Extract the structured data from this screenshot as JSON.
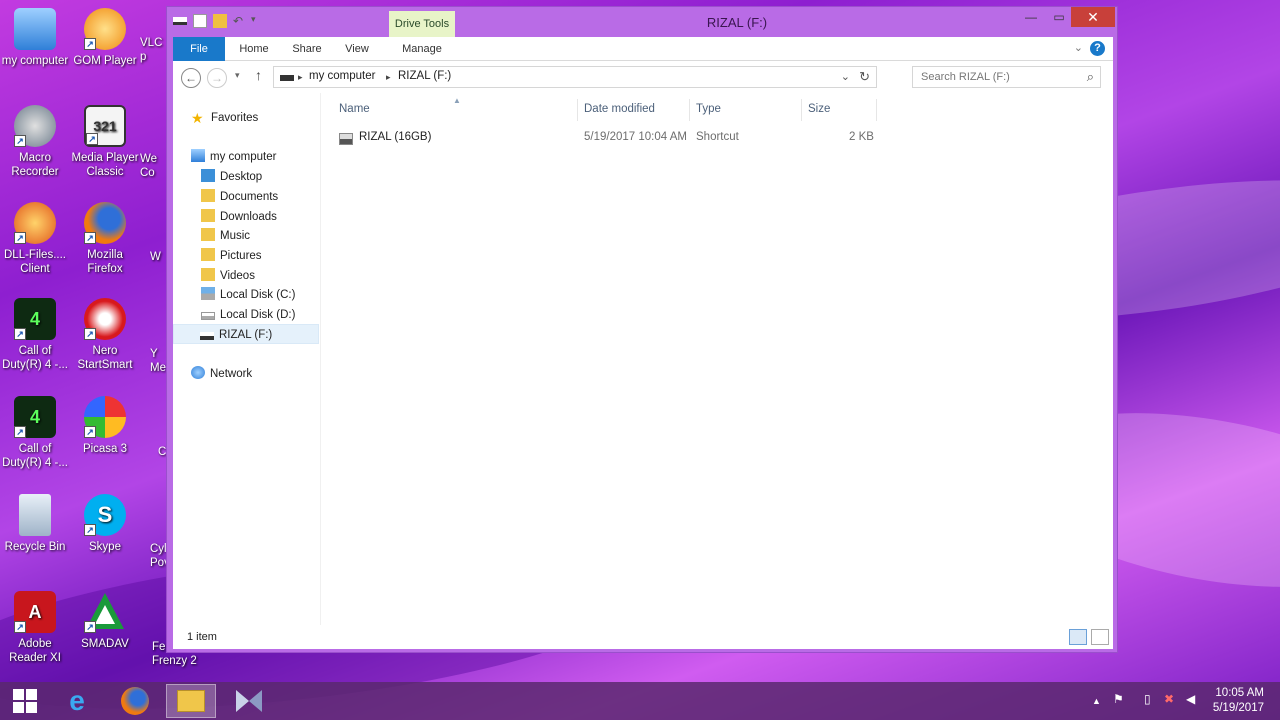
{
  "desktop": {
    "icons": [
      {
        "label": "my computer"
      },
      {
        "label": "GOM Player"
      },
      {
        "label": "VLC\np"
      },
      {
        "label": "Macro\nRecorder"
      },
      {
        "label": "Media Player\nClassic"
      },
      {
        "label": "We\nCo"
      },
      {
        "label": "DLL-Files....\nClient"
      },
      {
        "label": "Mozilla\nFirefox"
      },
      {
        "label": "W"
      },
      {
        "label": "Call of\nDuty(R) 4 -..."
      },
      {
        "label": "Nero\nStartSmart"
      },
      {
        "label": "Y\nMe"
      },
      {
        "label": "Call of\nDuty(R) 4 -..."
      },
      {
        "label": "Picasa 3"
      },
      {
        "label": "C"
      },
      {
        "label": "Recycle Bin"
      },
      {
        "label": "Skype"
      },
      {
        "label": "Cyl\nPov"
      },
      {
        "label": "Adobe\nReader XI"
      },
      {
        "label": "SMADAV"
      },
      {
        "label": "Fe\nFrenzy 2"
      }
    ]
  },
  "window": {
    "title": "RIZAL (F:)",
    "contextual_tab": "Drive Tools",
    "ribbon_tabs": [
      "File",
      "Home",
      "Share",
      "View",
      "Manage"
    ],
    "address": {
      "root": "my computer",
      "current": "RIZAL (F:)"
    },
    "search_placeholder": "Search RIZAL (F:)",
    "nav": {
      "favorites": "Favorites",
      "computer": "my computer",
      "items": [
        "Desktop",
        "Documents",
        "Downloads",
        "Music",
        "Pictures",
        "Videos",
        "Local Disk (C:)",
        "Local Disk (D:)",
        "RIZAL (F:)"
      ],
      "network": "Network"
    },
    "columns": [
      "Name",
      "Date modified",
      "Type",
      "Size"
    ],
    "files": [
      {
        "name": "RIZAL (16GB)",
        "date": "5/19/2017 10:04 AM",
        "type": "Shortcut",
        "size": "2 KB"
      }
    ],
    "status": "1 item"
  },
  "taskbar": {
    "clock_time": "10:05 AM",
    "clock_date": "5/19/2017"
  }
}
